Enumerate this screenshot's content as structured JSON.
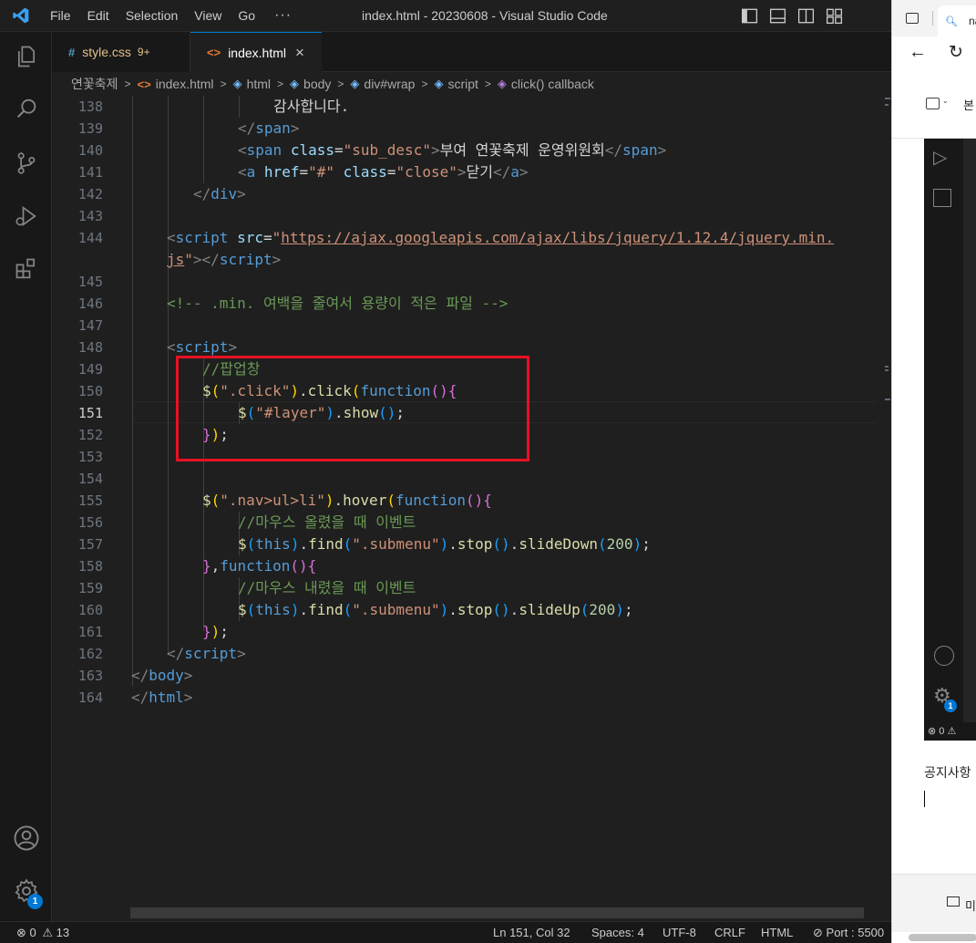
{
  "titlebar": {
    "menu": [
      "File",
      "Edit",
      "Selection",
      "View",
      "Go"
    ],
    "more": "···",
    "window_title": "index.html - 20230608 - Visual Studio Code"
  },
  "tabs": [
    {
      "label": "style.css",
      "count": "9+",
      "icon": "css-file-icon"
    },
    {
      "label": "index.html",
      "icon": "html-file-icon",
      "close": "×",
      "active": true
    }
  ],
  "breadcrumb": [
    "연꽃축제",
    "index.html",
    "html",
    "body",
    "div#wrap",
    "script",
    "click() callback"
  ],
  "editor": {
    "active_line": 151,
    "line_numbers": [
      138,
      139,
      140,
      141,
      142,
      143,
      144,
      145,
      146,
      147,
      148,
      149,
      150,
      151,
      152,
      153,
      154,
      155,
      156,
      157,
      158,
      159,
      160,
      161,
      162,
      163,
      164
    ],
    "code": {
      "l138": "감사합니다.",
      "l139_tag": "span",
      "l140_tag": "span",
      "l140_attr": "class",
      "l140_val": "\"sub_desc\"",
      "l140_text": "부여 연꽃축제 운영위원회",
      "l141_tag": "a",
      "l141_attr1": "href",
      "l141_val1": "\"#\"",
      "l141_attr2": "class",
      "l141_val2": "\"close\"",
      "l141_text": "닫기",
      "l142_tag": "div",
      "l144_tag": "script",
      "l144_attr": "src",
      "l144_url_a": "https://ajax.googleapis.com/ajax/libs/jquery/1.12.4/jquery.min.",
      "l144_url_b": "js",
      "l146_comment": "<!-- .min. 여백을 줄여서 용량이 적은 파일 -->",
      "l148_tag": "script",
      "l149_comment": "//팝업창",
      "l150_sel": "\".click\"",
      "l150_fn": "click",
      "l150_kw": "function",
      "l151_sel": "\"#layer\"",
      "l151_fn": "show",
      "l155_sel": "\".nav>ul>li\"",
      "l155_fn": "hover",
      "l155_kw": "function",
      "l156_comment": "//마우스 올렸을 때 이벤트",
      "l157_this": "this",
      "l157_find": "find",
      "l157_sel": "\".submenu\"",
      "l157_stop": "stop",
      "l157_slide": "slideDown",
      "l157_num": "200",
      "l158_kw": "function",
      "l159_comment": "//마우스 내렸을 때 이벤트",
      "l160_this": "this",
      "l160_find": "find",
      "l160_sel": "\".submenu\"",
      "l160_stop": "stop",
      "l160_slide": "slideUp",
      "l160_num": "200",
      "l162_tag": "script",
      "l163_tag": "body",
      "l164_tag": "html"
    }
  },
  "statusbar": {
    "errors": "0",
    "warnings": "13",
    "position": "Ln 151, Col 32",
    "spaces": "Spaces: 4",
    "encoding": "UTF-8",
    "eol": "CRLF",
    "language": "HTML",
    "port": "Port : 5500"
  },
  "activity_badge": "1",
  "right_panel": {
    "tab_text": "na",
    "toolbar_text": "본",
    "inner_status": "0",
    "notice_text": "공지사항",
    "inner_badge": "1",
    "bottom_text": "미"
  },
  "colors": {
    "accent": "#0078d4",
    "highlight_box": "#e81123"
  }
}
